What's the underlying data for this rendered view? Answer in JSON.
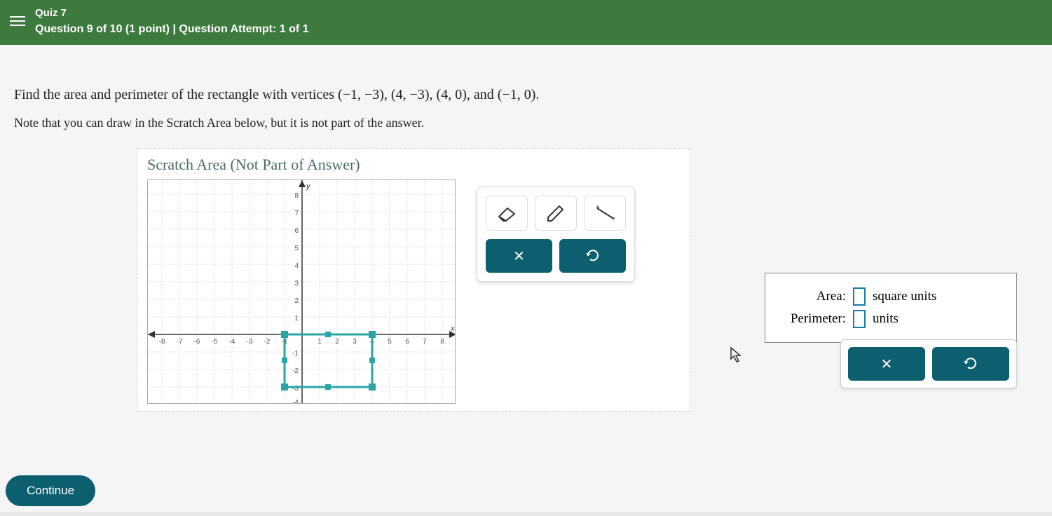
{
  "header": {
    "quiz_title": "Quiz 7",
    "question_line": "Question 9 of 10 (1 point)  |  Question Attempt: 1 of 1"
  },
  "question": {
    "prompt_pre": "Find the area and perimeter of the rectangle with vertices ",
    "v1": "(−1,  −3)",
    "v2": "(4,  −3)",
    "v3": "(4,  0)",
    "v4": "(−1,  0)",
    "prompt_post": ".",
    "note": "Note that you can draw in the Scratch Area below, but it is not part of the answer."
  },
  "scratch": {
    "title": "Scratch Area (Not Part of Answer)",
    "axes": {
      "x_label": "x",
      "y_label": "y",
      "range": [
        -8,
        8
      ]
    },
    "rectangle_vertices": [
      [
        -1,
        -3
      ],
      [
        4,
        -3
      ],
      [
        4,
        0
      ],
      [
        -1,
        0
      ]
    ]
  },
  "tools": {
    "eraser": "eraser",
    "pencil": "pencil",
    "line": "line",
    "clear": "×",
    "reset": "↺"
  },
  "answers": {
    "area_label": "Area:",
    "area_unit": "square units",
    "perimeter_label": "Perimeter:",
    "perimeter_unit": "units",
    "area_value": "",
    "perimeter_value": ""
  },
  "footer": {
    "continue": "Continue"
  }
}
